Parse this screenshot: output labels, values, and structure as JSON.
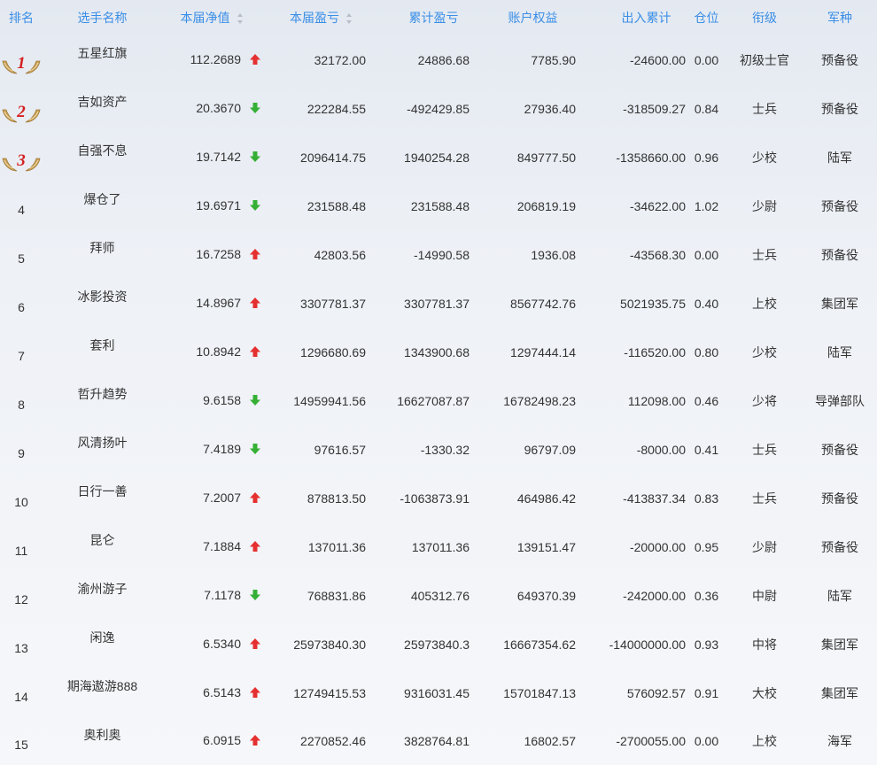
{
  "headers": {
    "rank": "排名",
    "name": "选手名称",
    "net_value": "本届净值",
    "profit": "本届盈亏",
    "total_profit": "累计盈亏",
    "equity": "账户权益",
    "flow": "出入累计",
    "position": "仓位",
    "title": "衔级",
    "branch": "军种"
  },
  "colors": {
    "header_text": "#3a8ee6",
    "up": "#e53030",
    "down": "#35b035",
    "medal_gold": "#c9a15a",
    "medal_num": "#d41f1f"
  },
  "rows": [
    {
      "rank": "1",
      "name": "五星红旗",
      "net": "112.2689",
      "trend": "up",
      "profit": "32172.00",
      "total": "24886.68",
      "equity": "7785.90",
      "flow": "-24600.00",
      "pos": "0.00",
      "title": "初级士官",
      "branch": "预备役"
    },
    {
      "rank": "2",
      "name": "吉如资产",
      "net": "20.3670",
      "trend": "down",
      "profit": "222284.55",
      "total": "-492429.85",
      "equity": "27936.40",
      "flow": "-318509.27",
      "pos": "0.84",
      "title": "士兵",
      "branch": "预备役"
    },
    {
      "rank": "3",
      "name": "自强不息",
      "net": "19.7142",
      "trend": "down",
      "profit": "2096414.75",
      "total": "1940254.28",
      "equity": "849777.50",
      "flow": "-1358660.00",
      "pos": "0.96",
      "title": "少校",
      "branch": "陆军"
    },
    {
      "rank": "4",
      "name": "爆仓了",
      "net": "19.6971",
      "trend": "down",
      "profit": "231588.48",
      "total": "231588.48",
      "equity": "206819.19",
      "flow": "-34622.00",
      "pos": "1.02",
      "title": "少尉",
      "branch": "预备役"
    },
    {
      "rank": "5",
      "name": "拜师",
      "net": "16.7258",
      "trend": "up",
      "profit": "42803.56",
      "total": "-14990.58",
      "equity": "1936.08",
      "flow": "-43568.30",
      "pos": "0.00",
      "title": "士兵",
      "branch": "预备役"
    },
    {
      "rank": "6",
      "name": "冰影投资",
      "net": "14.8967",
      "trend": "up",
      "profit": "3307781.37",
      "total": "3307781.37",
      "equity": "8567742.76",
      "flow": "5021935.75",
      "pos": "0.40",
      "title": "上校",
      "branch": "集团军"
    },
    {
      "rank": "7",
      "name": "套利",
      "net": "10.8942",
      "trend": "up",
      "profit": "1296680.69",
      "total": "1343900.68",
      "equity": "1297444.14",
      "flow": "-116520.00",
      "pos": "0.80",
      "title": "少校",
      "branch": "陆军"
    },
    {
      "rank": "8",
      "name": "哲升趋势",
      "net": "9.6158",
      "trend": "down",
      "profit": "14959941.56",
      "total": "16627087.87",
      "equity": "16782498.23",
      "flow": "112098.00",
      "pos": "0.46",
      "title": "少将",
      "branch": "导弹部队"
    },
    {
      "rank": "9",
      "name": "风清扬叶",
      "net": "7.4189",
      "trend": "down",
      "profit": "97616.57",
      "total": "-1330.32",
      "equity": "96797.09",
      "flow": "-8000.00",
      "pos": "0.41",
      "title": "士兵",
      "branch": "预备役"
    },
    {
      "rank": "10",
      "name": "日行一善",
      "net": "7.2007",
      "trend": "up",
      "profit": "878813.50",
      "total": "-1063873.91",
      "equity": "464986.42",
      "flow": "-413837.34",
      "pos": "0.83",
      "title": "士兵",
      "branch": "预备役"
    },
    {
      "rank": "11",
      "name": "昆仑",
      "net": "7.1884",
      "trend": "up",
      "profit": "137011.36",
      "total": "137011.36",
      "equity": "139151.47",
      "flow": "-20000.00",
      "pos": "0.95",
      "title": "少尉",
      "branch": "预备役"
    },
    {
      "rank": "12",
      "name": "渝州游子",
      "net": "7.1178",
      "trend": "down",
      "profit": "768831.86",
      "total": "405312.76",
      "equity": "649370.39",
      "flow": "-242000.00",
      "pos": "0.36",
      "title": "中尉",
      "branch": "陆军"
    },
    {
      "rank": "13",
      "name": "闲逸",
      "net": "6.5340",
      "trend": "up",
      "profit": "25973840.30",
      "total": "25973840.3",
      "equity": "16667354.62",
      "flow": "-14000000.00",
      "pos": "0.93",
      "title": "中将",
      "branch": "集团军"
    },
    {
      "rank": "14",
      "name": "期海遨游888",
      "net": "6.5143",
      "trend": "up",
      "profit": "12749415.53",
      "total": "9316031.45",
      "equity": "15701847.13",
      "flow": "576092.57",
      "pos": "0.91",
      "title": "大校",
      "branch": "集团军"
    },
    {
      "rank": "15",
      "name": "奥利奥",
      "net": "6.0915",
      "trend": "up",
      "profit": "2270852.46",
      "total": "3828764.81",
      "equity": "16802.57",
      "flow": "-2700055.00",
      "pos": "0.00",
      "title": "上校",
      "branch": "海军"
    }
  ]
}
